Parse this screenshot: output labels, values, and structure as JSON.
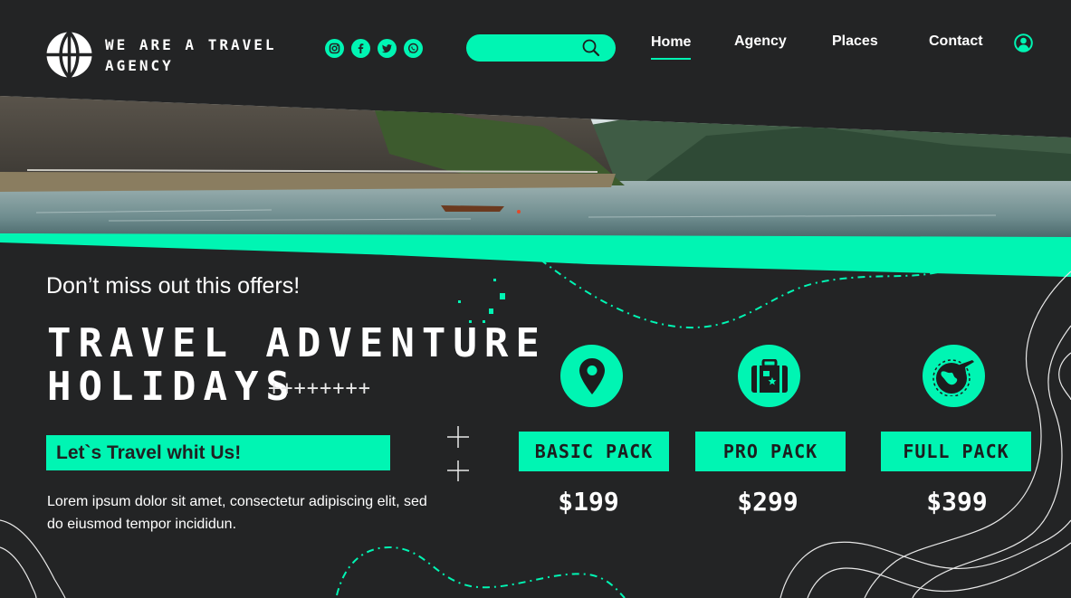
{
  "brand": {
    "name": "WE ARE A TRAVEL\nAGENCY",
    "logo_icon": "globe-icon",
    "accent": "#00f5b3",
    "background": "#232425"
  },
  "socials": [
    {
      "icon": "instagram-icon"
    },
    {
      "icon": "facebook-icon"
    },
    {
      "icon": "twitter-icon"
    },
    {
      "icon": "whatsapp-icon"
    }
  ],
  "search": {
    "value": "",
    "placeholder": "",
    "icon": "search-icon"
  },
  "nav": {
    "home": "Home",
    "agency": "Agency",
    "places": "Places",
    "contact": "Contact",
    "active": "Home",
    "user_icon": "user-icon"
  },
  "hero": {
    "image": "lake-landscape-photo"
  },
  "promo": {
    "offer": "Don’t miss out this offers!",
    "headline": "TRAVEL ADVENTURE\nHOLIDAYS",
    "decoration": "++++++++",
    "cta": "Let`s Travel whit Us!",
    "description": "Lorem ipsum dolor sit amet, consectetur adipiscing elit, sed do eiusmod tempor incididun."
  },
  "packs": [
    {
      "name": "BASIC PACK",
      "price": "$199",
      "icon": "map-pin-icon"
    },
    {
      "name": "PRO PACK",
      "price": "$299",
      "icon": "suitcase-icon"
    },
    {
      "name": "FULL PACK",
      "price": "$399",
      "icon": "globe-plane-icon"
    }
  ]
}
